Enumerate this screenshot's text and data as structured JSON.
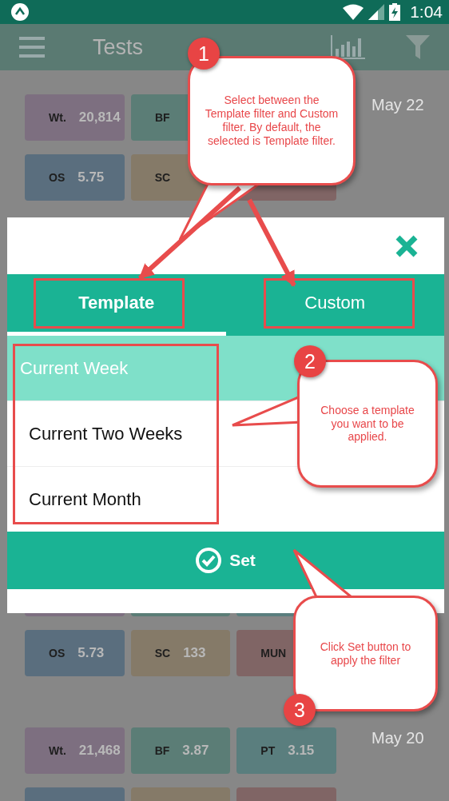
{
  "status_bar": {
    "time": "1:04"
  },
  "app_bar": {
    "title": "Tests"
  },
  "groups": [
    {
      "date": "May 22",
      "rows": [
        [
          {
            "label": "Wt.",
            "value": "20,814",
            "color": "#7d6f80"
          },
          {
            "label": "BF",
            "color": "#5b7d76"
          }
        ],
        [
          {
            "label": "OS",
            "value": "5.75",
            "color": "#5a6e7e"
          },
          {
            "label": "SC",
            "color": "#857a68"
          },
          {
            "color": "#806565"
          }
        ]
      ]
    },
    {
      "rows": [
        [
          {
            "color": "#7d6f80"
          },
          {
            "color": "#5b7d76"
          },
          {
            "color": "#5a7e7e"
          }
        ],
        [
          {
            "label": "OS",
            "value": "5.73",
            "color": "#5a6e7e"
          },
          {
            "label": "SC",
            "value": "133",
            "color": "#857a68"
          },
          {
            "label": "MUN",
            "color": "#806565"
          }
        ]
      ]
    },
    {
      "date": "May 20",
      "rows": [
        [
          {
            "label": "Wt.",
            "value": "21,468",
            "color": "#7d6f80"
          },
          {
            "label": "BF",
            "value": "3.87",
            "color": "#5b7d76"
          },
          {
            "label": "PT",
            "value": "3.15",
            "color": "#5a7e7e"
          }
        ],
        [
          {
            "color": "#5a6e7e"
          },
          {
            "color": "#857a68"
          },
          {
            "color": "#806565"
          }
        ]
      ]
    }
  ],
  "dialog": {
    "tabs": [
      {
        "label": "Template",
        "selected": true
      },
      {
        "label": "Custom",
        "selected": false
      }
    ],
    "templates": [
      {
        "label": "Current Week",
        "selected": true
      },
      {
        "label": "Current Two Weeks",
        "selected": false
      },
      {
        "label": "Current Month",
        "selected": false
      }
    ],
    "set_button": "Set"
  },
  "annotations": [
    {
      "number": "1",
      "text": "Select between the Template filter and Custom filter. By default, the selected is Template filter."
    },
    {
      "number": "2",
      "text": "Choose a template you want to be applied."
    },
    {
      "number": "3",
      "text": "Click Set button to apply the filter"
    }
  ]
}
